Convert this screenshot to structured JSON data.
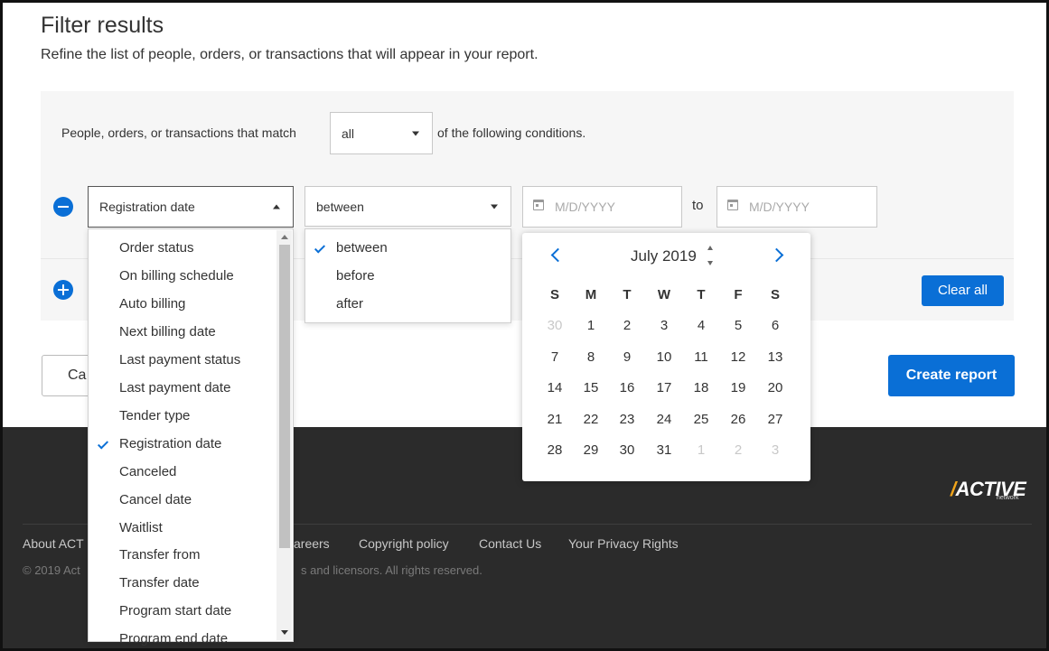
{
  "page": {
    "title": "Filter results",
    "subtitle": "Refine the list of people, orders, or transactions that will appear in your report."
  },
  "conditions": {
    "prefix": "People, orders, or transactions that match",
    "match_value": "all",
    "suffix": "of the following conditions."
  },
  "filter_row": {
    "field_value": "Registration date",
    "operator_value": "between",
    "start_placeholder": "M/D/YYYY",
    "to_label": "to",
    "end_placeholder": "M/D/YYYY"
  },
  "field_dropdown": {
    "items": [
      {
        "label": "Order status",
        "selected": false
      },
      {
        "label": "On billing schedule",
        "selected": false
      },
      {
        "label": "Auto billing",
        "selected": false
      },
      {
        "label": "Next billing date",
        "selected": false
      },
      {
        "label": "Last payment status",
        "selected": false
      },
      {
        "label": "Last payment date",
        "selected": false
      },
      {
        "label": "Tender type",
        "selected": false
      },
      {
        "label": "Registration date",
        "selected": true
      },
      {
        "label": "Canceled",
        "selected": false
      },
      {
        "label": "Cancel date",
        "selected": false
      },
      {
        "label": "Waitlist",
        "selected": false
      },
      {
        "label": "Transfer from",
        "selected": false
      },
      {
        "label": "Transfer date",
        "selected": false
      },
      {
        "label": "Program start date",
        "selected": false
      },
      {
        "label": "Program end date",
        "selected": false
      }
    ]
  },
  "operator_dropdown": {
    "items": [
      {
        "label": "between",
        "selected": true
      },
      {
        "label": "before",
        "selected": false
      },
      {
        "label": "after",
        "selected": false
      }
    ]
  },
  "calendar": {
    "month_label": "July 2019",
    "weekdays": [
      "S",
      "M",
      "T",
      "W",
      "T",
      "F",
      "S"
    ],
    "weeks": [
      [
        {
          "d": "30",
          "m": true
        },
        {
          "d": "1"
        },
        {
          "d": "2"
        },
        {
          "d": "3"
        },
        {
          "d": "4"
        },
        {
          "d": "5"
        },
        {
          "d": "6"
        }
      ],
      [
        {
          "d": "7"
        },
        {
          "d": "8"
        },
        {
          "d": "9"
        },
        {
          "d": "10"
        },
        {
          "d": "11"
        },
        {
          "d": "12"
        },
        {
          "d": "13"
        }
      ],
      [
        {
          "d": "14"
        },
        {
          "d": "15"
        },
        {
          "d": "16"
        },
        {
          "d": "17"
        },
        {
          "d": "18"
        },
        {
          "d": "19"
        },
        {
          "d": "20"
        }
      ],
      [
        {
          "d": "21"
        },
        {
          "d": "22"
        },
        {
          "d": "23"
        },
        {
          "d": "24"
        },
        {
          "d": "25"
        },
        {
          "d": "26"
        },
        {
          "d": "27"
        }
      ],
      [
        {
          "d": "28"
        },
        {
          "d": "29"
        },
        {
          "d": "30"
        },
        {
          "d": "31"
        },
        {
          "d": "1",
          "m": true
        },
        {
          "d": "2",
          "m": true
        },
        {
          "d": "3",
          "m": true
        }
      ]
    ]
  },
  "actions": {
    "clear_all": "Clear all",
    "cancel_visible": "Ca",
    "create_report": "Create report"
  },
  "footer": {
    "links_visible": [
      "About ACT",
      "areers",
      "Copyright policy",
      "Contact Us",
      "Your Privacy Rights"
    ],
    "copyright_left": "© 2019 Act",
    "copyright_right": "s and licensors. All rights reserved.",
    "logo_text": "ACTIVE",
    "logo_sub": "network"
  },
  "colors": {
    "accent": "#0a6fd6",
    "panel_bg": "#f6f6f6",
    "footer_bg": "#2b2b2b",
    "logo_accent": "#f2a51a"
  },
  "icons": {
    "remove_condition": "minus-circle-icon",
    "add_condition": "plus-circle-icon",
    "date": "calendar-icon",
    "check": "check-icon"
  }
}
